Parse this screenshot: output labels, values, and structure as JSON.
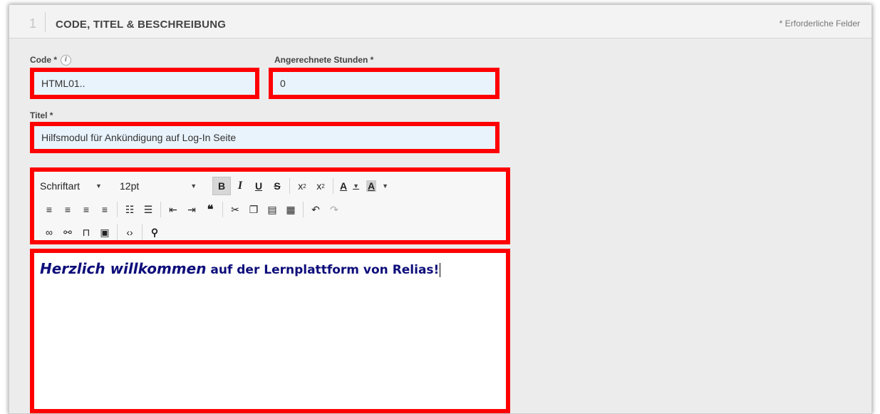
{
  "section": {
    "number": "1",
    "title": "CODE, TITEL & BESCHREIBUNG",
    "required_note": "* Erforderliche Felder"
  },
  "fields": {
    "code": {
      "label": "Code *",
      "value": "HTML01.."
    },
    "hours": {
      "label": "Angerechnete Stunden *",
      "value": "0"
    },
    "title": {
      "label": "Titel *",
      "value": "Hilfsmodul für Ankündigung auf Log-In Seite"
    }
  },
  "toolbar": {
    "font_family": "Schriftart",
    "font_size": "12pt",
    "icons": {
      "row1": [
        "bold-icon",
        "italic-icon",
        "underline-icon",
        "strikethrough-icon",
        "subscript-icon",
        "superscript-icon",
        "font-color-icon",
        "background-color-icon"
      ],
      "row2": [
        "align-left-icon",
        "align-center-icon",
        "align-right-icon",
        "align-justify-icon",
        "bulleted-list-icon",
        "numbered-list-icon",
        "outdent-icon",
        "indent-icon",
        "blockquote-icon",
        "cut-icon",
        "copy-icon",
        "paste-icon",
        "paste-text-icon",
        "undo-icon",
        "redo-icon"
      ],
      "row3": [
        "link-icon",
        "unlink-icon",
        "bookmark-icon",
        "image-icon",
        "source-code-icon",
        "find-icon"
      ]
    }
  },
  "editor": {
    "emphasis": "Herzlich willkommen",
    "rest": " auf der Lernplattform von Relias!"
  },
  "colors": {
    "highlight": "#ff0000",
    "editor_text": "#0d0d7a",
    "input_bg": "#e9f3fb"
  }
}
